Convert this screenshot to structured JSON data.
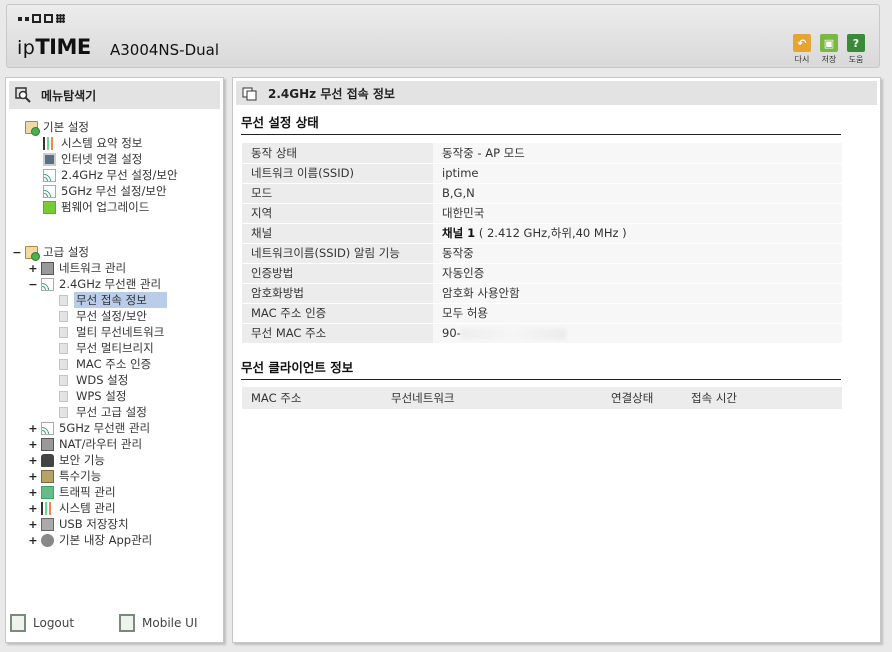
{
  "header": {
    "logo_small": "ip",
    "logo_big": "TIME",
    "model": "A3004NS-Dual",
    "buttons": [
      {
        "label": "다시",
        "icon": "undo-icon",
        "color": "#e8a431"
      },
      {
        "label": "저장",
        "icon": "save-icon",
        "color": "#7bb842"
      },
      {
        "label": "도움",
        "icon": "help-icon",
        "color": "#3a8a3a"
      }
    ]
  },
  "sidebar": {
    "title": "메뉴탐색기",
    "groups": {
      "basic": {
        "label": "기본 설정",
        "items": [
          "시스템 요약 정보",
          "인터넷 연결 설정",
          "2.4GHz 무선 설정/보안",
          "5GHz 무선 설정/보안",
          "펌웨어 업그레이드"
        ]
      },
      "advanced": {
        "label": "고급 설정",
        "items": [
          {
            "label": "네트워크 관리",
            "toggle": "+"
          },
          {
            "label": "2.4GHz 무선랜 관리",
            "toggle": "−"
          },
          {
            "label": "5GHz 무선랜 관리",
            "toggle": "+"
          },
          {
            "label": "NAT/라우터 관리",
            "toggle": "+"
          },
          {
            "label": "보안 기능",
            "toggle": "+"
          },
          {
            "label": "특수기능",
            "toggle": "+"
          },
          {
            "label": "트래픽 관리",
            "toggle": "+"
          },
          {
            "label": "시스템 관리",
            "toggle": "+"
          },
          {
            "label": "USB 저장장치",
            "toggle": "+"
          },
          {
            "label": "기본 내장 App관리",
            "toggle": "+"
          }
        ],
        "wifi24_children": [
          "무선 접속 정보",
          "무선 설정/보안",
          "멀티 무선네트워크",
          "무선 멀티브리지",
          "MAC 주소 인증",
          "WDS 설정",
          "WPS 설정",
          "무선 고급 설정"
        ]
      }
    },
    "footer": {
      "logout": "Logout",
      "mobile": "Mobile UI"
    }
  },
  "main": {
    "title": "2.4GHz 무선 접속 정보",
    "status_section": "무선 설정 상태",
    "rows": [
      {
        "key": "동작 상태",
        "value": "동작중 - AP 모드"
      },
      {
        "key": "네트워크 이름(SSID)",
        "value": "iptime"
      },
      {
        "key": "모드",
        "value": "B,G,N"
      },
      {
        "key": "지역",
        "value": "대한민국"
      },
      {
        "key": "채널",
        "value_bold": "채널 1",
        "value": " ( 2.412 GHz,하위,40 MHz )"
      },
      {
        "key": "네트워크이름(SSID) 알림 기능",
        "value": "동작중"
      },
      {
        "key": "인증방법",
        "value": "자동인증"
      },
      {
        "key": "암호화방법",
        "value": "암호화 사용안함"
      },
      {
        "key": "MAC 주소 인증",
        "value": "모두 허용"
      },
      {
        "key": "무선 MAC 주소",
        "value": "90-"
      }
    ],
    "client_section": "무선 클라이언트 정보",
    "client_headers": [
      "MAC 주소",
      "무선네트워크",
      "연결상태",
      "접속 시간"
    ]
  }
}
